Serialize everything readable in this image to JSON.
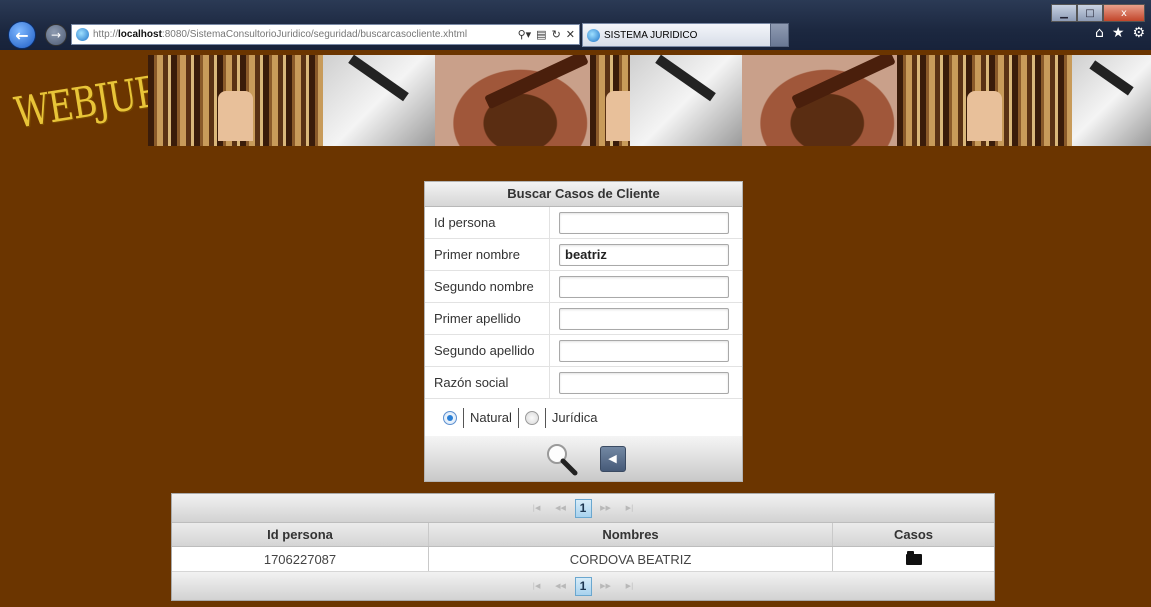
{
  "browser": {
    "url_prefix": "http://",
    "url_host": "localhost",
    "url_rest": ":8080/SistemaConsultorioJuridico/seguridad/buscarcasocliente.xhtml",
    "tab_title": "SISTEMA JURIDICO",
    "tab_close": "×",
    "win_min": "▁",
    "win_max": "□",
    "win_close": "x"
  },
  "logo": {
    "text": "WEBJURIS"
  },
  "search_panel": {
    "title": "Buscar Casos de Cliente",
    "fields": [
      {
        "label": "Id persona",
        "value": ""
      },
      {
        "label": "Primer nombre",
        "value": "beatriz"
      },
      {
        "label": "Segundo nombre",
        "value": ""
      },
      {
        "label": "Primer apellido",
        "value": ""
      },
      {
        "label": "Segundo apellido",
        "value": ""
      },
      {
        "label": "Razón social",
        "value": ""
      }
    ],
    "radio": {
      "options": [
        "Natural",
        "Jurídica"
      ],
      "selected": "Natural"
    },
    "buttons": {
      "search": "search-icon",
      "back": "◀"
    }
  },
  "results": {
    "pager": {
      "first": "|◀",
      "prev": "◀◀",
      "current": "1",
      "next": "▶▶",
      "last": "▶|"
    },
    "columns": [
      "Id persona",
      "Nombres",
      "Casos"
    ],
    "rows": [
      {
        "id": "1706227087",
        "nombres": "CORDOVA BEATRIZ",
        "casos_icon": "folder-icon"
      }
    ]
  }
}
